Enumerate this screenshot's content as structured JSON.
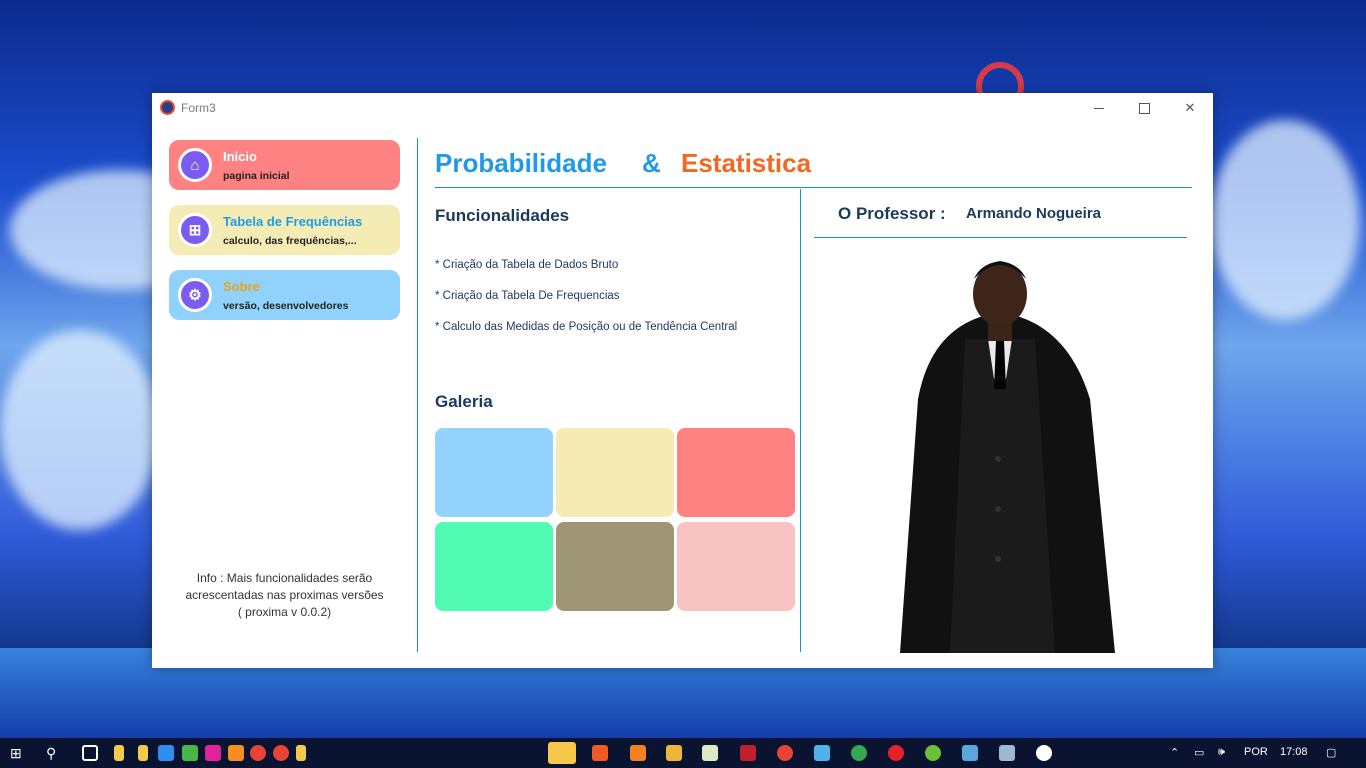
{
  "window": {
    "title": "Form3"
  },
  "sidebar": {
    "items": [
      {
        "title": "Inicio",
        "subtitle": "pagina inicial",
        "icon": "home-icon",
        "color": "#ff8282"
      },
      {
        "title": "Tabela de Frequências",
        "subtitle": "calculo, das frequências,...",
        "icon": "grid-icon",
        "color": "#f5ebb4"
      },
      {
        "title": "Sobre",
        "subtitle": "versão, desenvolvedores",
        "icon": "gear-icon",
        "color": "#90d2fc"
      }
    ],
    "info_line1": "Info : Mais funcionalidades serão",
    "info_line2": "acrescentadas nas proximas versões",
    "info_line3": "( proxima v 0.0.2)"
  },
  "header": {
    "title_part1": "Probabilidade",
    "ampersand": "&",
    "title_part2": "Estatistica"
  },
  "features": {
    "heading": "Funcionalidades",
    "items": [
      "* Criação da Tabela de Dados Bruto",
      "* Criação da Tabela De Frequencias",
      "* Calculo das Medidas de Posição ou de Tendência Central"
    ]
  },
  "gallery": {
    "heading": "Galeria",
    "colors": [
      "#92d2fd",
      "#f5ebb4",
      "#ff8282",
      "#52fbb4",
      "#9e9675",
      "#f8c3c3"
    ]
  },
  "professor": {
    "label": "O Professor :",
    "name": "Armando Nogueira"
  },
  "taskbar": {
    "language": "POR",
    "time": "17:08"
  }
}
